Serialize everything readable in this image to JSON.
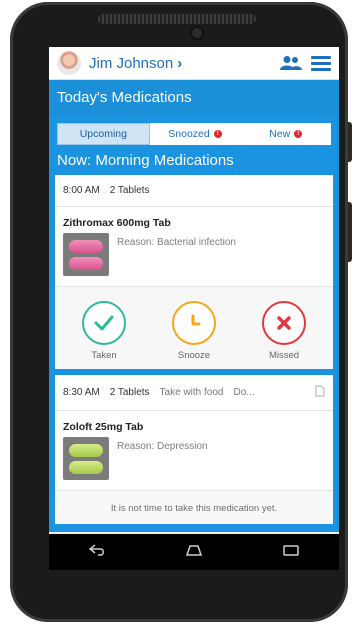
{
  "header": {
    "user_name": "Jim Johnson"
  },
  "titlebar": {
    "title": "Today's Medications"
  },
  "tabs": [
    {
      "label": "Upcoming",
      "alert": ""
    },
    {
      "label": "Snoozed",
      "alert": "!"
    },
    {
      "label": "New",
      "alert": "!"
    }
  ],
  "section_title": "Now: Morning Medications",
  "med1": {
    "time": "8:00 AM",
    "dose": "2 Tablets",
    "name": "Zithromax 600mg Tab",
    "reason": "Reason: Bacterial infection",
    "pill_color": "pink"
  },
  "actions": {
    "taken": "Taken",
    "snooze": "Snooze",
    "missed": "Missed"
  },
  "med2": {
    "time": "8:30 AM",
    "dose": "2 Tablets",
    "instructions": "Take with food",
    "extra": "Do...",
    "name": "Zoloft 25mg Tab",
    "reason": "Reason: Depression",
    "notice": "It is not time to take this medication yet.",
    "pill_color": "green"
  },
  "colors": {
    "accent": "#1a93e0",
    "taken": "#2eb99b",
    "snooze": "#f3a81b",
    "missed": "#e4373e"
  },
  "icons": {
    "contacts": "people-icon",
    "menu": "hamburger-icon",
    "nav_back": "back-icon",
    "nav_home": "home-icon",
    "nav_recent": "recent-apps-icon"
  }
}
